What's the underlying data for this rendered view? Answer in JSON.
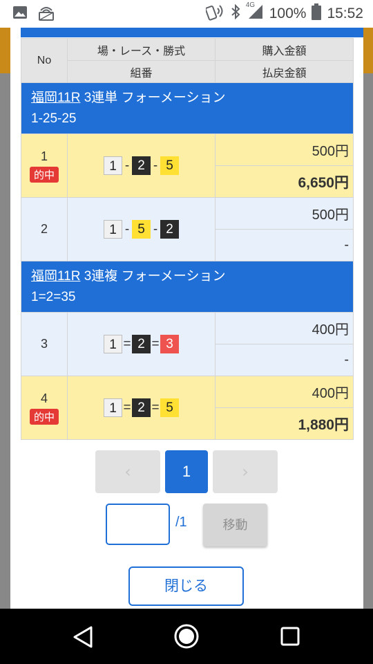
{
  "status_bar": {
    "network": "4G",
    "battery": "100%",
    "time": "15:52"
  },
  "table": {
    "headers": {
      "no": "No",
      "venue_race_bet": "場・レース・勝式",
      "combination": "組番",
      "purchase_amount": "購入金額",
      "payout_amount": "払戻金額"
    },
    "groups": [
      {
        "venue_race": "福岡11R",
        "bet_type": "3連単 フォーメーション",
        "formation": "1-25-25",
        "rows": [
          {
            "no": "1",
            "hit_label": "的中",
            "nums": [
              "1",
              "2",
              "5"
            ],
            "separator": "-",
            "purchase": "500円",
            "payout": "6,650円"
          },
          {
            "no": "2",
            "hit_label": "",
            "nums": [
              "1",
              "5",
              "2"
            ],
            "separator": "-",
            "purchase": "500円",
            "payout": "-"
          }
        ]
      },
      {
        "venue_race": "福岡11R",
        "bet_type": "3連複 フォーメーション",
        "formation": "1=2=35",
        "rows": [
          {
            "no": "3",
            "hit_label": "",
            "nums": [
              "1",
              "2",
              "3"
            ],
            "separator": "=",
            "purchase": "400円",
            "payout": "-"
          },
          {
            "no": "4",
            "hit_label": "的中",
            "nums": [
              "1",
              "2",
              "5"
            ],
            "separator": "=",
            "purchase": "400円",
            "payout": "1,880円"
          }
        ]
      }
    ]
  },
  "pager": {
    "prev_icon": "‹",
    "current": "1",
    "next_icon": "›",
    "total": "/1",
    "move_label": "移動",
    "input_value": ""
  },
  "close_label": "閉じる",
  "colors": {
    "accent_blue": "#1f6fd6",
    "hit_red": "#e53935",
    "row_yellow": "#fdf0a6",
    "row_blue": "#e8f0fb"
  }
}
